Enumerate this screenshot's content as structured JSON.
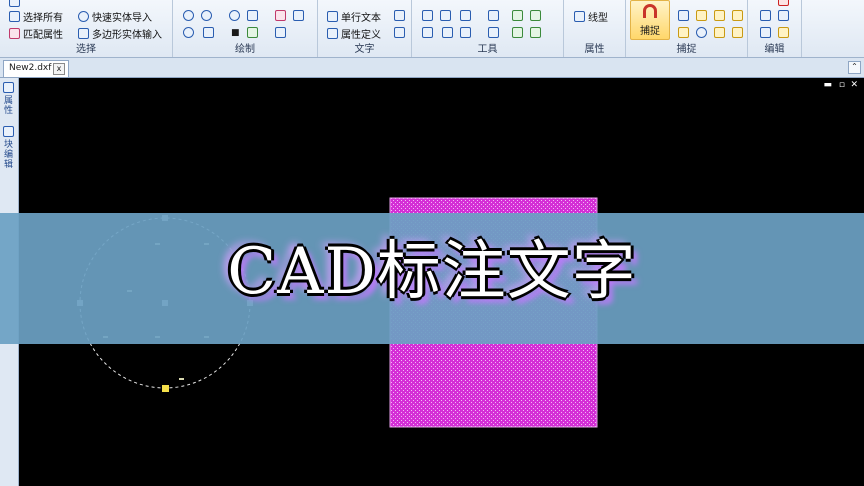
{
  "ribbon": {
    "select_group": {
      "label": "选择",
      "items": [
        "选择所有",
        "匹配属性",
        "快速实体导入",
        "多边形实体输入"
      ]
    },
    "draw_group": {
      "label": "绘制"
    },
    "text_group": {
      "label": "文字",
      "items": [
        "单行文本",
        "属性定义"
      ]
    },
    "tools_group": {
      "label": "工具"
    },
    "props_group": {
      "label": "属性",
      "items": [
        "线型"
      ]
    },
    "snap_group": {
      "label": "捕捉",
      "button": "捕捉"
    },
    "edit_group": {
      "label": "编辑"
    }
  },
  "tabs": {
    "document": "New2.dxf",
    "close": "x"
  },
  "sidebar": {
    "tab1": "属性",
    "tab2": "块编辑"
  },
  "canvas": {
    "controls": [
      "▬",
      "▫",
      "✕"
    ]
  },
  "overlay": {
    "title": "CAD标注文字"
  },
  "colors": {
    "canvas_bg": "#000000",
    "hatch": "#d42fd6",
    "banner": "#6ca0c3",
    "grip": "#f5e04a"
  }
}
